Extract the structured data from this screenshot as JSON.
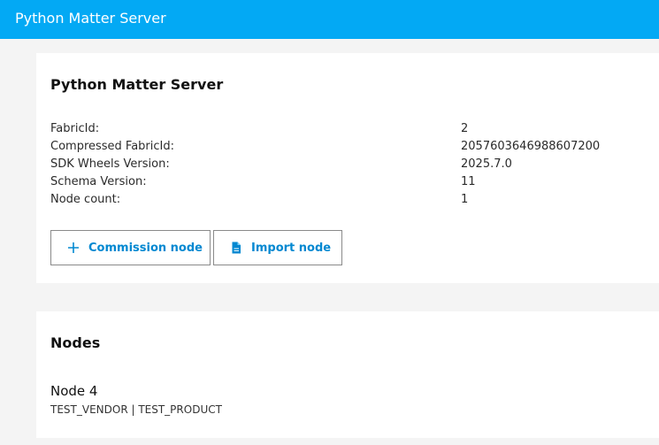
{
  "header": {
    "title": "Python Matter Server"
  },
  "server_card": {
    "title": "Python Matter Server",
    "info": [
      {
        "key": "FabricId:",
        "value": "2"
      },
      {
        "key": "Compressed FabricId:",
        "value": "2057603646988607200"
      },
      {
        "key": "SDK Wheels Version:",
        "value": "2025.7.0"
      },
      {
        "key": "Schema Version:",
        "value": "11"
      },
      {
        "key": "Node count:",
        "value": "1"
      }
    ],
    "commission_label": "Commission node",
    "import_label": "Import node"
  },
  "nodes_card": {
    "title": "Nodes",
    "nodes": [
      {
        "name": "Node 4",
        "details": "TEST_VENDOR | TEST_PRODUCT"
      }
    ]
  },
  "colors": {
    "accent": "#03a9f4",
    "button_text": "#0288d1",
    "background": "#f4f4f4"
  },
  "icons": {
    "commission": "plus-icon",
    "import": "file-icon"
  }
}
